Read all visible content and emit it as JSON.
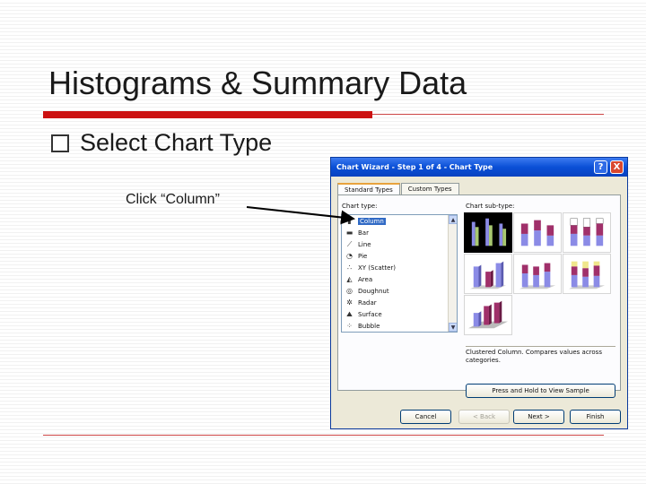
{
  "slide": {
    "title": "Histograms & Summary Data",
    "bullet": "Select Chart Type",
    "sub_bullet": "Click “Column”"
  },
  "dialog": {
    "title": "Chart Wizard - Step 1 of 4 - Chart Type",
    "help_button": "?",
    "close_button": "X",
    "tabs": [
      {
        "label": "Standard Types",
        "active": true
      },
      {
        "label": "Custom Types",
        "active": false
      }
    ],
    "chart_type_label": "Chart type:",
    "chart_subtype_label": "Chart sub-type:",
    "chart_types": [
      {
        "label": "Column",
        "icon": "column-chart-icon",
        "glyph": "▮",
        "selected": true
      },
      {
        "label": "Bar",
        "icon": "bar-chart-icon",
        "glyph": "▬",
        "selected": false
      },
      {
        "label": "Line",
        "icon": "line-chart-icon",
        "glyph": "⟋",
        "selected": false
      },
      {
        "label": "Pie",
        "icon": "pie-chart-icon",
        "glyph": "◔",
        "selected": false
      },
      {
        "label": "XY (Scatter)",
        "icon": "scatter-chart-icon",
        "glyph": "∴",
        "selected": false
      },
      {
        "label": "Area",
        "icon": "area-chart-icon",
        "glyph": "◭",
        "selected": false
      },
      {
        "label": "Doughnut",
        "icon": "doughnut-chart-icon",
        "glyph": "◎",
        "selected": false
      },
      {
        "label": "Radar",
        "icon": "radar-chart-icon",
        "glyph": "✲",
        "selected": false
      },
      {
        "label": "Surface",
        "icon": "surface-chart-icon",
        "glyph": "⛰",
        "selected": false
      },
      {
        "label": "Bubble",
        "icon": "bubble-chart-icon",
        "glyph": "⁘",
        "selected": false
      }
    ],
    "subtypes_count_selected_index": 0,
    "description": "Clustered Column. Compares values across categories.",
    "sample_button": "Press and Hold to View Sample",
    "footer": {
      "cancel": "Cancel",
      "back": "< Back",
      "next": "Next >",
      "finish": "Finish"
    }
  },
  "colors": {
    "accent_red": "#cc1111",
    "titlebar_blue": "#0a4fd6",
    "selection_blue": "#316ac5",
    "series_purple": "#8b8be6",
    "series_maroon": "#a0306a",
    "series_green": "#a8c870"
  }
}
